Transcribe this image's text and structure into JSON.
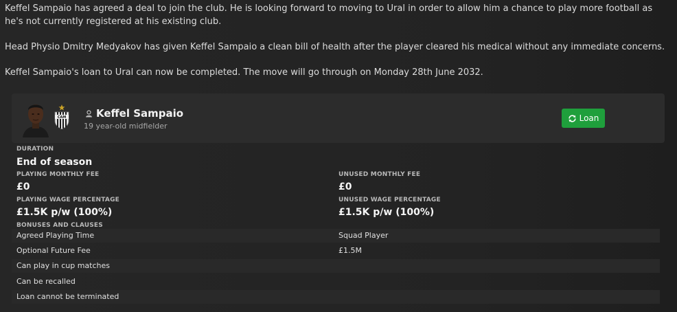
{
  "messages": {
    "agreed": "Keffel Sampaio has agreed a deal to join the club. He is looking forward to moving to Ural in order to allow him a chance to play more football as he's not currently registered at his existing club.",
    "medical": "Head Physio Dmitry Medyakov has given Keffel Sampaio a clean bill of health after the player cleared his medical without any immediate concerns.",
    "loan": "Keffel Sampaio's loan to Ural can now be completed. The move will go through on Monday 28th June 2032."
  },
  "player": {
    "name": "Keffel Sampaio",
    "description": "19 year-old midfielder",
    "icons": {
      "avatar": "player-face",
      "club": "club-crest",
      "status": "person-icon"
    }
  },
  "action": {
    "label": "Loan",
    "icon": "refresh-icon",
    "color": "#1f9f3c"
  },
  "terms": {
    "duration_label": "DURATION",
    "duration_value": "End of season",
    "playing_fee_label": "PLAYING MONTHLY FEE",
    "playing_fee_value": "£0",
    "unused_fee_label": "UNUSED MONTHLY FEE",
    "unused_fee_value": "£0",
    "playing_wage_label": "PLAYING WAGE PERCENTAGE",
    "playing_wage_value": "£1.5K p/w (100%)",
    "unused_wage_label": "UNUSED WAGE PERCENTAGE",
    "unused_wage_value": "£1.5K p/w (100%)",
    "bonuses_label": "BONUSES AND CLAUSES"
  },
  "clauses": [
    {
      "name": "Agreed Playing Time",
      "value": "Squad Player"
    },
    {
      "name": "Optional Future Fee",
      "value": "£1.5M"
    },
    {
      "name": "Can play in cup matches",
      "value": ""
    },
    {
      "name": "Can be recalled",
      "value": ""
    },
    {
      "name": "Loan cannot be terminated",
      "value": ""
    }
  ]
}
